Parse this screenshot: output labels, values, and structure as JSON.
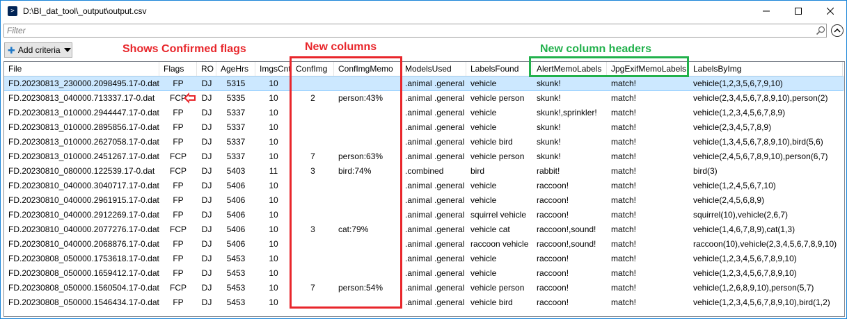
{
  "window": {
    "title": "D:\\BI_dat_tool\\_output\\output.csv",
    "icon": "powershell-icon",
    "controls": [
      "minimize",
      "maximize",
      "close"
    ]
  },
  "filter": {
    "placeholder": "Filter",
    "value": ""
  },
  "toolbar": {
    "add_criteria_label": "Add criteria"
  },
  "annotations": {
    "confirmed_flags": "Shows Confirmed flags",
    "new_columns": "New columns",
    "new_column_headers": "New column headers"
  },
  "colors": {
    "annotation_red": "#e8262b",
    "annotation_green": "#22b14c",
    "selected_row": "#cce8ff",
    "window_border": "#1883d7"
  },
  "table": {
    "columns": [
      "File",
      "Flags",
      "RO",
      "AgeHrs",
      "ImgsCnt",
      "ConfImg",
      "ConfImgMemo",
      "ModelsUsed",
      "LabelsFound",
      "AlertMemoLabels",
      "JpgExifMemoLabels",
      "LabelsByImg"
    ],
    "selected_index": 0,
    "rows": [
      [
        "FD.20230813_230000.2098495.17-0.dat",
        "FP",
        "DJ",
        "5315",
        "10",
        "",
        "",
        ".animal .general",
        "vehicle",
        "skunk!",
        "match!",
        "vehicle(1,2,3,5,6,7,9,10)"
      ],
      [
        "FD.20230813_040000.713337.17-0.dat",
        "FCP",
        "DJ",
        "5335",
        "10",
        "2",
        "person:43%",
        ".animal .general",
        "vehicle person",
        "skunk!",
        "match!",
        "vehicle(2,3,4,5,6,7,8,9,10),person(2)"
      ],
      [
        "FD.20230813_010000.2944447.17-0.dat",
        "FP",
        "DJ",
        "5337",
        "10",
        "",
        "",
        ".animal .general",
        "vehicle",
        "skunk!,sprinkler!",
        "match!",
        "vehicle(1,2,3,4,5,6,7,8,9)"
      ],
      [
        "FD.20230813_010000.2895856.17-0.dat",
        "FP",
        "DJ",
        "5337",
        "10",
        "",
        "",
        ".animal .general",
        "vehicle",
        "skunk!",
        "match!",
        "vehicle(2,3,4,5,7,8,9)"
      ],
      [
        "FD.20230813_010000.2627058.17-0.dat",
        "FP",
        "DJ",
        "5337",
        "10",
        "",
        "",
        ".animal .general",
        "vehicle bird",
        "skunk!",
        "match!",
        "vehicle(1,3,4,5,6,7,8,9,10),bird(5,6)"
      ],
      [
        "FD.20230813_010000.2451267.17-0.dat",
        "FCP",
        "DJ",
        "5337",
        "10",
        "7",
        "person:63%",
        ".animal .general",
        "vehicle person",
        "skunk!",
        "match!",
        "vehicle(2,4,5,6,7,8,9,10),person(6,7)"
      ],
      [
        "FD.20230810_080000.122539.17-0.dat",
        "FCP",
        "DJ",
        "5403",
        "11",
        "3",
        "bird:74%",
        ".combined",
        "bird",
        "rabbit!",
        "match!",
        "bird(3)"
      ],
      [
        "FD.20230810_040000.3040717.17-0.dat",
        "FP",
        "DJ",
        "5406",
        "10",
        "",
        "",
        ".animal .general",
        "vehicle",
        "raccoon!",
        "match!",
        "vehicle(1,2,4,5,6,7,10)"
      ],
      [
        "FD.20230810_040000.2961915.17-0.dat",
        "FP",
        "DJ",
        "5406",
        "10",
        "",
        "",
        ".animal .general",
        "vehicle",
        "raccoon!",
        "match!",
        "vehicle(2,4,5,6,8,9)"
      ],
      [
        "FD.20230810_040000.2912269.17-0.dat",
        "FP",
        "DJ",
        "5406",
        "10",
        "",
        "",
        ".animal .general",
        "squirrel vehicle",
        "raccoon!",
        "match!",
        "squirrel(10),vehicle(2,6,7)"
      ],
      [
        "FD.20230810_040000.2077276.17-0.dat",
        "FCP",
        "DJ",
        "5406",
        "10",
        "3",
        "cat:79%",
        ".animal .general",
        "vehicle cat",
        "raccoon!,sound!",
        "match!",
        "vehicle(1,4,6,7,8,9),cat(1,3)"
      ],
      [
        "FD.20230810_040000.2068876.17-0.dat",
        "FP",
        "DJ",
        "5406",
        "10",
        "",
        "",
        ".animal .general",
        "raccoon vehicle",
        "raccoon!,sound!",
        "match!",
        "raccoon(10),vehicle(2,3,4,5,6,7,8,9,10)"
      ],
      [
        "FD.20230808_050000.1753618.17-0.dat",
        "FP",
        "DJ",
        "5453",
        "10",
        "",
        "",
        ".animal .general",
        "vehicle",
        "raccoon!",
        "match!",
        "vehicle(1,2,3,4,5,6,7,8,9,10)"
      ],
      [
        "FD.20230808_050000.1659412.17-0.dat",
        "FP",
        "DJ",
        "5453",
        "10",
        "",
        "",
        ".animal .general",
        "vehicle",
        "raccoon!",
        "match!",
        "vehicle(1,2,3,4,5,6,7,8,9,10)"
      ],
      [
        "FD.20230808_050000.1560504.17-0.dat",
        "FCP",
        "DJ",
        "5453",
        "10",
        "7",
        "person:54%",
        ".animal .general",
        "vehicle person",
        "raccoon!",
        "match!",
        "vehicle(1,2,6,8,9,10),person(5,7)"
      ],
      [
        "FD.20230808_050000.1546434.17-0.dat",
        "FP",
        "DJ",
        "5453",
        "10",
        "",
        "",
        ".animal .general",
        "vehicle bird",
        "raccoon!",
        "match!",
        "vehicle(1,2,3,4,5,6,7,8,9,10),bird(1,2)"
      ]
    ]
  }
}
